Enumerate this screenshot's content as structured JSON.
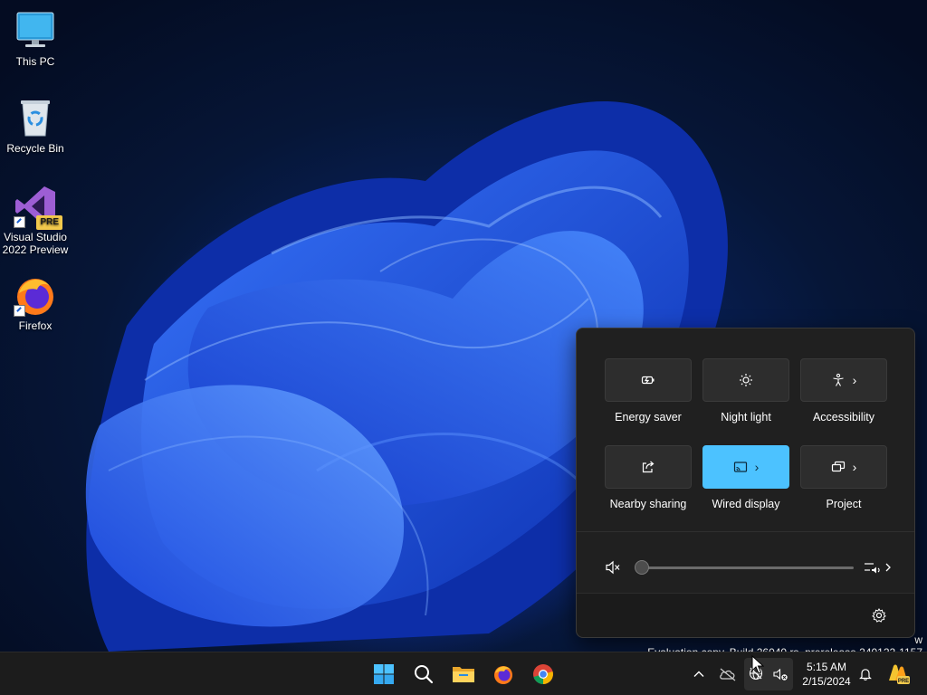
{
  "desktop": {
    "icons": [
      {
        "label": "This PC",
        "icon": "monitor-icon"
      },
      {
        "label": "Recycle Bin",
        "icon": "recycle-bin-icon"
      },
      {
        "label": "Visual Studio 2022 Preview",
        "icon": "visual-studio-icon",
        "badge": "PRE"
      },
      {
        "label": "Firefox",
        "icon": "firefox-icon"
      }
    ]
  },
  "quick_settings": {
    "tiles": [
      {
        "label": "Energy saver",
        "icon": "energy-saver-icon",
        "active": false,
        "has_chevron": false
      },
      {
        "label": "Night light",
        "icon": "night-light-icon",
        "active": false,
        "has_chevron": false
      },
      {
        "label": "Accessibility",
        "icon": "accessibility-icon",
        "active": false,
        "has_chevron": true
      },
      {
        "label": "Nearby sharing",
        "icon": "share-icon",
        "active": false,
        "has_chevron": false
      },
      {
        "label": "Wired display",
        "icon": "cast-icon",
        "active": true,
        "has_chevron": true
      },
      {
        "label": "Project",
        "icon": "project-icon",
        "active": false,
        "has_chevron": true
      }
    ],
    "volume": {
      "muted": true,
      "level": 0
    },
    "accent_color": "#4cc2ff"
  },
  "watermark": {
    "line1_tail": "w",
    "line2": "Evaluation copy. Build 26040.rs_prerelease.240122-1157"
  },
  "taskbar": {
    "apps": [
      "start-icon",
      "search-icon",
      "file-explorer-icon",
      "firefox-icon",
      "chrome-icon"
    ],
    "clock": {
      "time": "5:15 AM",
      "date": "2/15/2024"
    },
    "tray_chevron": "^"
  }
}
